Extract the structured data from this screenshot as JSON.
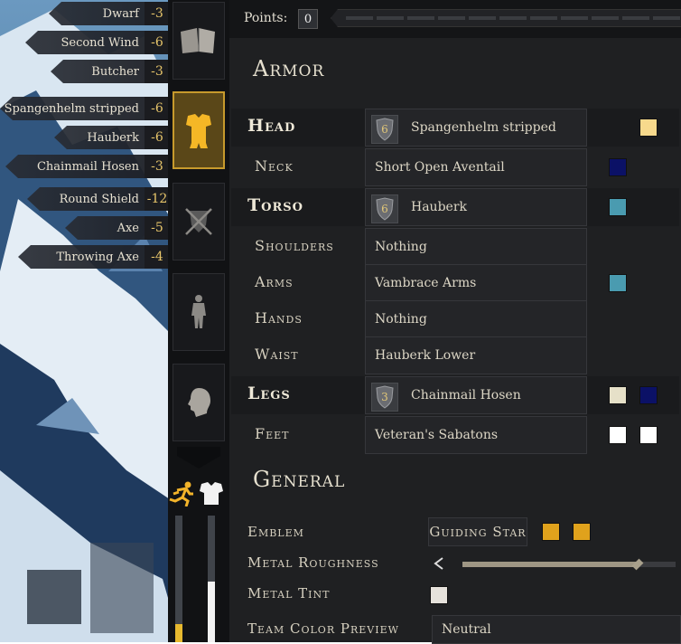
{
  "stats": [
    {
      "name": "Dwarf",
      "value": "-3"
    },
    {
      "name": "Second Wind",
      "value": "-6"
    },
    {
      "name": "Butcher",
      "value": "-3"
    },
    {
      "name": "Spangenhelm stripped",
      "value": "-6"
    },
    {
      "name": "Hauberk",
      "value": "-6"
    },
    {
      "name": "Chainmail Hosen",
      "value": "-3"
    },
    {
      "name": "Round Shield",
      "value": "-12"
    },
    {
      "name": "Axe",
      "value": "-5"
    },
    {
      "name": "Throwing Axe",
      "value": "-4"
    }
  ],
  "points": {
    "label": "Points:",
    "value": "0"
  },
  "armor": {
    "title": "Armor",
    "rows": [
      {
        "slot": "Head",
        "item": "Spangenhelm stripped",
        "tier": "6",
        "colors": [
          "#f7d98c"
        ]
      },
      {
        "slot": "Neck",
        "item": "Short Open Aventail",
        "colors": [
          "#0b1166"
        ]
      },
      {
        "slot": "Torso",
        "item": "Hauberk",
        "tier": "6",
        "colors": [
          "#4a9bb0"
        ]
      },
      {
        "slot": "Shoulders",
        "item": "Nothing",
        "colors": []
      },
      {
        "slot": "Arms",
        "item": "Vambrace Arms",
        "colors": [
          "#4a9bb0"
        ]
      },
      {
        "slot": "Hands",
        "item": "Nothing",
        "colors": []
      },
      {
        "slot": "Waist",
        "item": "Hauberk Lower",
        "colors": []
      },
      {
        "slot": "Legs",
        "item": "Chainmail Hosen",
        "tier": "3",
        "colors": [
          "#e6e0c8",
          "#0b1166"
        ]
      },
      {
        "slot": "Feet",
        "item": "Veteran's Sabatons",
        "colors": [
          "#ffffff",
          "#ffffff"
        ]
      }
    ]
  },
  "general": {
    "title": "General",
    "emblem": {
      "label": "Emblem",
      "value": "Guiding Star",
      "colors": [
        "#e0a21c",
        "#e0a21c"
      ]
    },
    "metal_roughness": {
      "label": "Metal Roughness",
      "level": 0.82
    },
    "metal_tint": {
      "label": "Metal Tint",
      "color": "#e6e2dc"
    },
    "team_color_preview": {
      "label": "Team Color Preview",
      "value": "Neutral"
    }
  },
  "meters": {
    "stamina_level": 0.14,
    "armor_level": 0.48
  },
  "icons": {
    "categories": [
      "book-icon",
      "armor-icon",
      "weapons-icon",
      "body-icon",
      "head-icon"
    ],
    "meters": [
      "running-icon",
      "armor-icon"
    ]
  },
  "colors": {
    "accent": "#c79a2c",
    "active_bg": "#5a4718",
    "value_gold": "#e7c56a"
  }
}
